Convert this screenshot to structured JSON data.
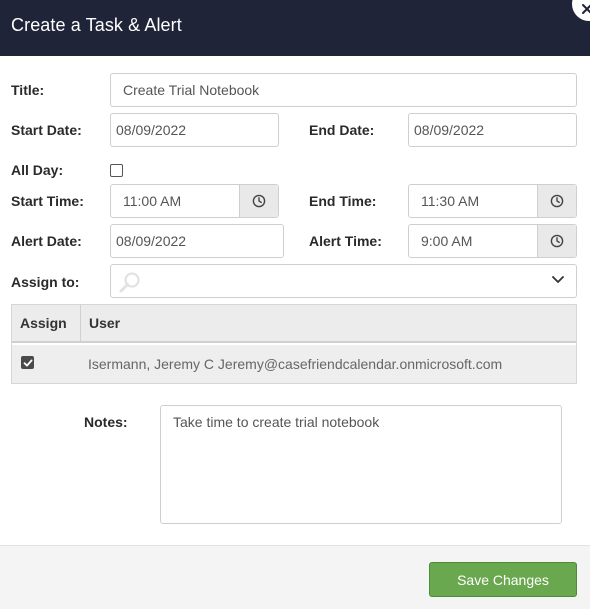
{
  "dialog": {
    "title": "Create a Task & Alert"
  },
  "form": {
    "title_label": "Title:",
    "title_value": "Create Trial Notebook",
    "start_date_label": "Start Date:",
    "start_date_value": "08/09/2022",
    "end_date_label": "End Date:",
    "end_date_value": "08/09/2022",
    "all_day_label": "All Day:",
    "all_day_checked": false,
    "start_time_label": "Start Time:",
    "start_time_value": "11:00 AM",
    "end_time_label": "End Time:",
    "end_time_value": "11:30 AM",
    "alert_date_label": "Alert Date:",
    "alert_date_value": "08/09/2022",
    "alert_time_label": "Alert Time:",
    "alert_time_value": "9:00 AM",
    "assign_to_label": "Assign to:",
    "assign_to_value": "",
    "notes_label": "Notes:",
    "notes_value": "Take time to create trial notebook"
  },
  "assign_table": {
    "headers": [
      "Assign",
      "User"
    ],
    "rows": [
      {
        "assigned": true,
        "user": "Isermann, Jeremy C Jeremy@casefriendcalendar.onmicrosoft.com"
      }
    ]
  },
  "footer": {
    "save_label": "Save Changes"
  },
  "icons": {
    "close": "close-icon",
    "clock": "clock-icon",
    "search": "search-icon",
    "chevron": "chevron-down-icon",
    "check": "check-icon"
  },
  "colors": {
    "header_bg": "#1f2438",
    "save_button": "#6aa84f"
  }
}
